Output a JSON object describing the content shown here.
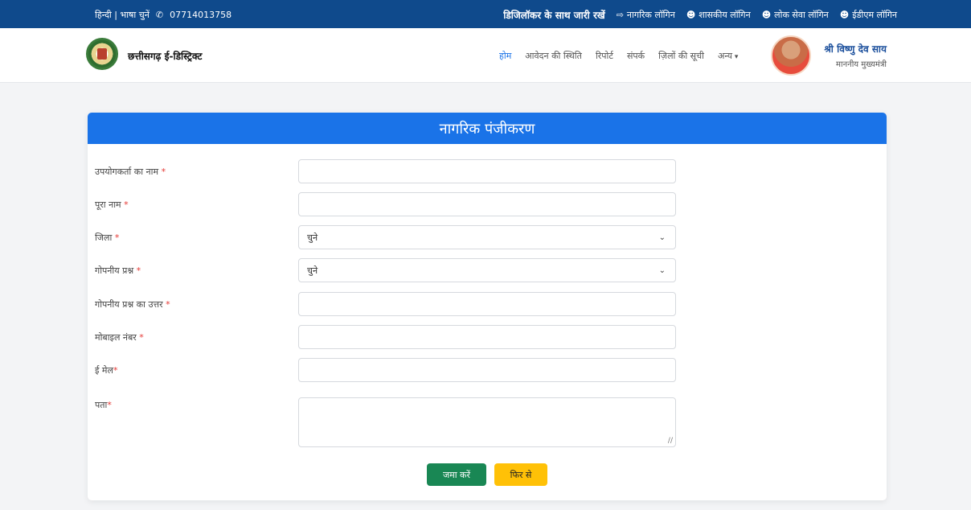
{
  "topbar": {
    "lang": "हिन्दी | भाषा चुनें",
    "phone_icon": "phone-icon",
    "phone": "07714013758",
    "digilocker": "डिजिलॉकर के साथ जारी रखें",
    "links": [
      {
        "label": "नागरिक लॉगिन",
        "icon": "login-icon"
      },
      {
        "label": "शासकीय लॉगिन",
        "icon": "user-icon"
      },
      {
        "label": "लोक सेवा लॉगिन",
        "icon": "user-icon"
      },
      {
        "label": "ईडीएम लॉगिन",
        "icon": "user-icon"
      }
    ]
  },
  "header": {
    "brand": "छत्तीसगढ़ ई-डिस्ट्रिक्ट",
    "nav": [
      "होम",
      "आवेदन की स्थिति",
      "रिपोर्ट",
      "संपर्क",
      "ज़िलों की सूची",
      "अन्य"
    ],
    "cm_name": "श्री विष्णु देव साय",
    "cm_title": "माननीय मुख्यमंत्री"
  },
  "form": {
    "title": "नागरिक पंजीकरण",
    "fields": [
      {
        "label": "उपयोगकर्ता का नाम",
        "req": " *",
        "type": "text",
        "value": ""
      },
      {
        "label": "पूरा नाम",
        "req": " *",
        "type": "text",
        "value": ""
      },
      {
        "label": "जिला",
        "req": " *",
        "type": "select",
        "value": "चुने"
      },
      {
        "label": "गोपनीय प्रश्न",
        "req": " *",
        "type": "select",
        "value": "चुने"
      },
      {
        "label": "गोपनीय प्रश्न का उत्तर",
        "req": " *",
        "type": "text",
        "value": ""
      },
      {
        "label": "मोबाइल नंबर",
        "req": " *",
        "type": "text",
        "value": ""
      },
      {
        "label": "ई मेल",
        "req": "*",
        "type": "text",
        "value": ""
      },
      {
        "label": "पता",
        "req": "*",
        "type": "textarea",
        "value": ""
      }
    ],
    "submit_label": "जमा करें",
    "reset_label": "फिर से"
  },
  "colors": {
    "topbar": "#0f4a8c",
    "accent": "#1a73e8",
    "submit": "#198754",
    "reset": "#ffc107"
  }
}
